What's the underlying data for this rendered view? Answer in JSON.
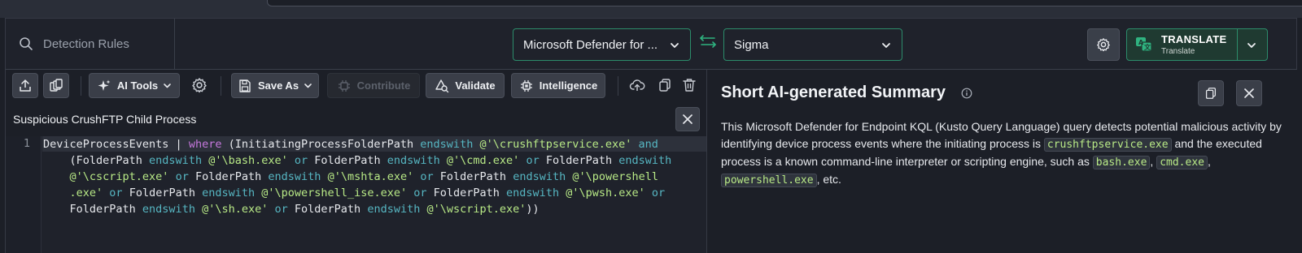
{
  "header": {
    "search_placeholder": "Detection Rules",
    "source_platform": "Microsoft Defender for ...",
    "target_platform": "Sigma",
    "translate_label": "TRANSLATE",
    "translate_sublabel": "Translate"
  },
  "toolbar": {
    "ai_tools_label": "AI Tools",
    "save_as_label": "Save As",
    "contribute_label": "Contribute",
    "validate_label": "Validate",
    "intelligence_label": "Intelligence"
  },
  "editor": {
    "rule_title": "Suspicious CrushFTP Child Process",
    "line_number": "1"
  },
  "summary": {
    "title": "Short AI-generated Summary",
    "text_1": "This Microsoft Defender for Endpoint KQL (Kusto Query Language) query detects potential malicious activity by identifying device process events where the initiating process is ",
    "chip_1": "crushftpservice.exe",
    "text_2": " and the executed process is a known command-line interpreter or scripting engine, such as ",
    "chip_2": "bash.exe",
    "sep_a": ", ",
    "chip_3": "cmd.exe",
    "sep_b": ", ",
    "chip_4": "powershell.exe",
    "text_3": ", etc."
  },
  "colors": {
    "accent": "#2c8c6b",
    "background": "#1c1f27",
    "code_string": "#b8e986",
    "code_keyword": "#c678dd",
    "code_operator": "#56b6c2"
  }
}
